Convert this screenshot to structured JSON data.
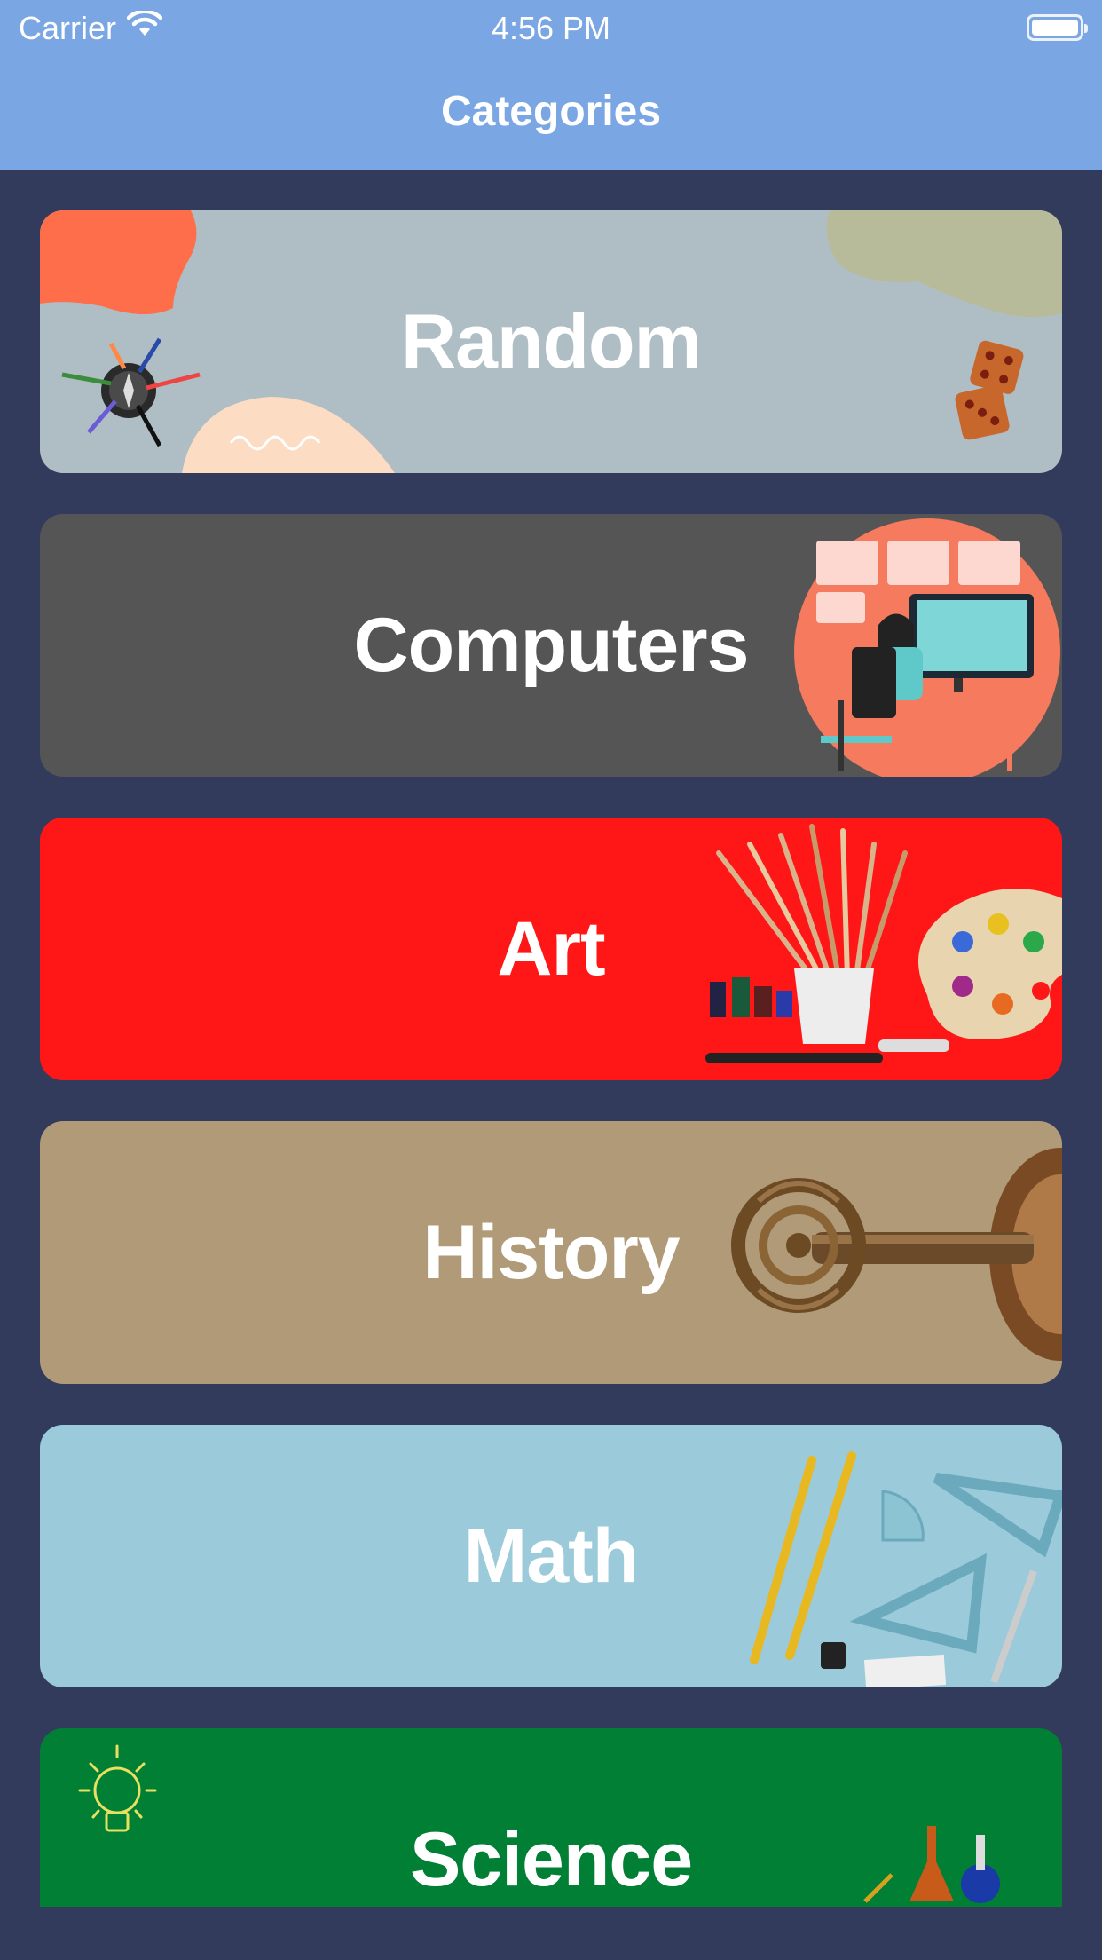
{
  "status_bar": {
    "carrier": "Carrier",
    "time": "4:56 PM",
    "icons": [
      "wifi-icon",
      "battery-icon"
    ]
  },
  "nav": {
    "title": "Categories",
    "background": "#7AA6E3"
  },
  "categories": [
    {
      "label": "Random",
      "color": "#AFBEC5",
      "illustration": "compass-arrows-dice"
    },
    {
      "label": "Computers",
      "color": "#555555",
      "illustration": "person-at-computer"
    },
    {
      "label": "Art",
      "color": "#FF1717",
      "illustration": "paintbrushes-palette"
    },
    {
      "label": "History",
      "color": "#B09A78",
      "illustration": "antique-key"
    },
    {
      "label": "Math",
      "color": "#9BCADB",
      "illustration": "pencils-protractor-triangles"
    },
    {
      "label": "Science",
      "color": "#007F35",
      "illustration": "lightbulb-lab-flasks"
    }
  ]
}
